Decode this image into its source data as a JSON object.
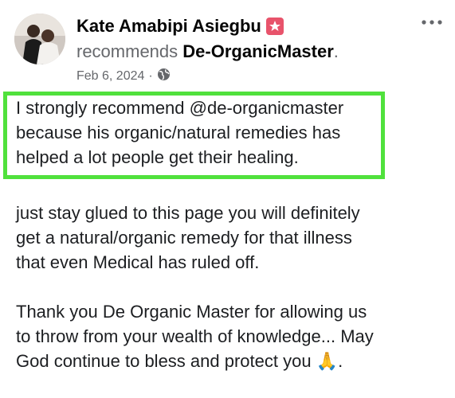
{
  "post": {
    "author_name": "Kate Amabipi Asiegbu",
    "recommends_verb": "recommends",
    "page_name": "De-OrganicMaster",
    "page_name_suffix": ".",
    "date": "Feb 6, 2024",
    "date_separator": "·",
    "privacy_icon": "globe-icon",
    "more_icon": "more-horizontal-icon",
    "highlighted_lines": [
      "I strongly recommend @de-organicmaster",
      "because his organic/natural remedies has",
      "helped a lot people get their healing."
    ],
    "paragraph_2_lines": [
      "just stay glued to this page you will definitely",
      "get a natural/organic remedy for that illness",
      "that even Medical has ruled off."
    ],
    "paragraph_3_lines": [
      "Thank you De Organic Master for allowing us",
      "to throw from your wealth of knowledge... May",
      "God continue to bless and protect you 🙏."
    ]
  },
  "colors": {
    "highlight_border": "#50e13c",
    "badge": "#e8536b",
    "secondary_text": "#65676b"
  }
}
